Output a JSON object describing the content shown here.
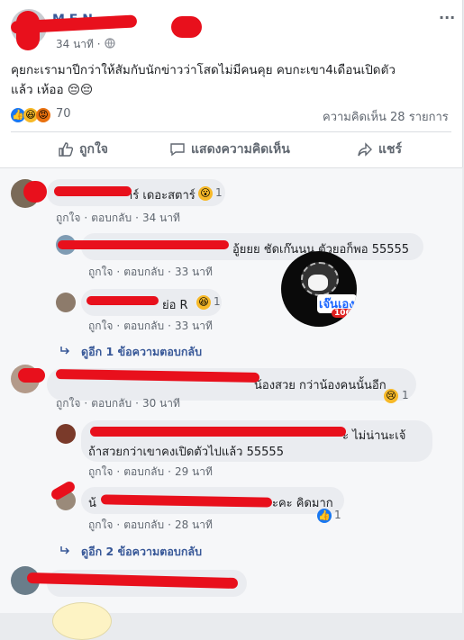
{
  "post": {
    "author": "M F N",
    "time": "34 นาที ·",
    "text_line1": "คุยกะเรามาปีกว่าให้สัมกับนักข่าวว่าโสดไม่มีคนคุย คบกะเขา4เดือนเปิดตัว",
    "text_line2": "แล้ว เห้ออ 😔😔",
    "reaction_count": "70",
    "comment_count": "ความคิดเห็น 28 รายการ",
    "more": "···"
  },
  "actions": {
    "like": "ถูกใจ",
    "comment": "แสดงความคิดเห็น",
    "share": "แชร์"
  },
  "comments": [
    {
      "text": "าร์ เดอะสตาร์",
      "reaction": "1",
      "like": "ถูกใจ",
      "reply": "ตอบกลับ",
      "time": "34 นาที"
    },
    {
      "text": "อู้ยยย ชัดเก๊นนน ตัวยอก็พอ 55555",
      "like": "ถูกใจ",
      "reply": "ตอบกลับ",
      "time": "33 นาที"
    },
    {
      "text": "ย่อ R",
      "reaction": "1",
      "like": "ถูกใจ",
      "reply": "ตอบกลับ",
      "time": "33 นาที"
    },
    {
      "text": "น้องสวย กว่าน้องคนนั้นอีก",
      "reaction": "1",
      "like": "ถูกใจ",
      "reply": "ตอบกลับ",
      "time": "30 นาที"
    },
    {
      "text_line1": "ะ ไม่น่านะเจ้",
      "text_line2": "ถ้าสวยกว่าเขาคงเปิดตัวไปแล้ว 55555",
      "like": "ถูกใจ",
      "reply": "ตอบกลับ",
      "time": "29 นาที"
    },
    {
      "text": "น้",
      "text_end": "ะคะ คิดมาก",
      "reaction": "1",
      "like": "ถูกใจ",
      "reply": "ตอบกลับ",
      "time": "28 นาที"
    }
  ],
  "view_replies_1": "ดูอีก 1 ข้อความตอบกลับ",
  "view_replies_2": "ดูอีก 2 ข้อความตอบกลับ",
  "sticker_text": "เจ๊นเอง",
  "sticker_num": "106",
  "colors": {
    "link": "#385898",
    "meta": "#606770",
    "redact": "#e8101c"
  }
}
